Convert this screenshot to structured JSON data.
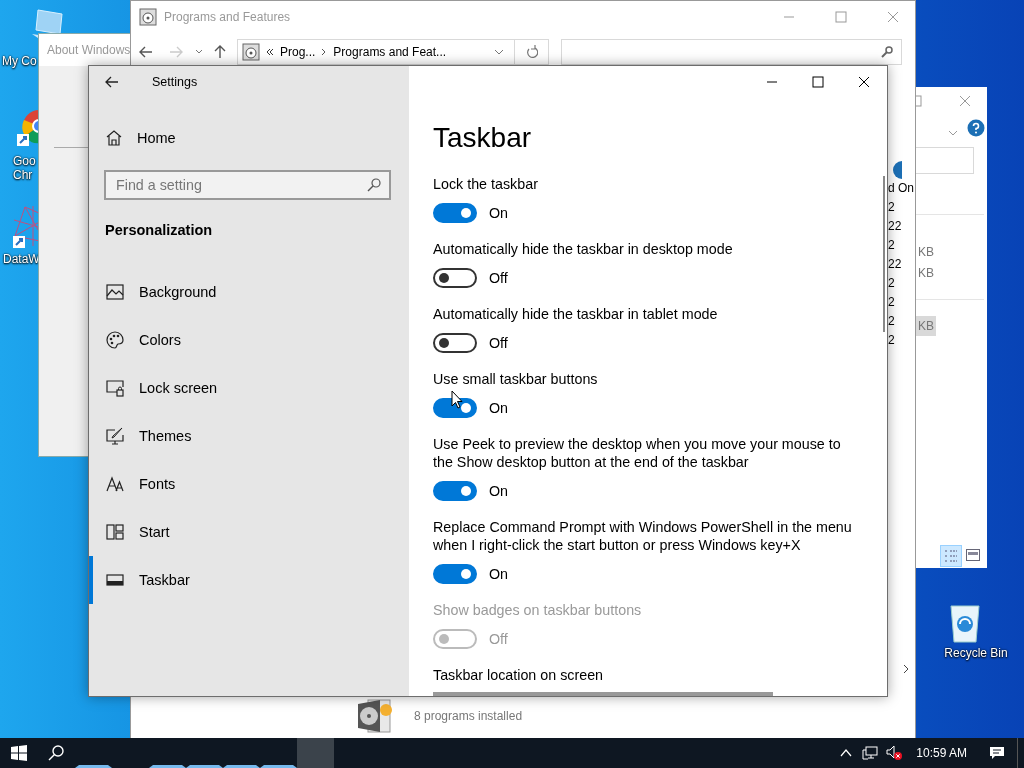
{
  "desktop_icons": [
    {
      "lines": [
        "My Co"
      ]
    },
    {
      "lines": [
        "Goo",
        "Chr"
      ]
    },
    {
      "lines": [
        "DataW"
      ]
    },
    {
      "lines": [
        "Recycle Bin"
      ]
    }
  ],
  "about_window": {
    "title": "About Windows"
  },
  "programs_window": {
    "title": "Programs and Features",
    "breadcrumb": [
      "Prog...",
      "Programs and Feat..."
    ],
    "column_header": "d On",
    "dates": [
      "2",
      "22",
      "2",
      "22",
      "2",
      "2",
      "2",
      "2"
    ],
    "status": "8 programs installed"
  },
  "right_window": {
    "sizes": [
      {
        "text": "KB",
        "selected": false
      },
      {
        "text": "KB",
        "selected": false
      },
      {
        "text": "KB",
        "selected": true
      }
    ]
  },
  "settings": {
    "title": "Settings",
    "home": "Home",
    "search": {
      "placeholder": "Find a setting"
    },
    "section": "Personalization",
    "nav": [
      {
        "label": "Background",
        "selected": false
      },
      {
        "label": "Colors",
        "selected": false
      },
      {
        "label": "Lock screen",
        "selected": false
      },
      {
        "label": "Themes",
        "selected": false
      },
      {
        "label": "Fonts",
        "selected": false
      },
      {
        "label": "Start",
        "selected": false
      },
      {
        "label": "Taskbar",
        "selected": true
      }
    ],
    "page_title": "Taskbar",
    "toggles": [
      {
        "label": "Lock the taskbar",
        "on": true,
        "disabled": false,
        "state_text": "On"
      },
      {
        "label": "Automatically hide the taskbar in desktop mode",
        "on": false,
        "disabled": false,
        "state_text": "Off"
      },
      {
        "label": "Automatically hide the taskbar in tablet mode",
        "on": false,
        "disabled": false,
        "state_text": "Off"
      },
      {
        "label": "Use small taskbar buttons",
        "on": true,
        "disabled": false,
        "state_text": "On"
      },
      {
        "label": "Use Peek to preview the desktop when you move your mouse to the Show desktop button at the end of the taskbar",
        "on": true,
        "disabled": false,
        "state_text": "On"
      },
      {
        "label": "Replace Command Prompt with Windows PowerShell in the menu when I right-click the start button or press Windows key+X",
        "on": true,
        "disabled": false,
        "state_text": "On"
      },
      {
        "label": "Show badges on taskbar buttons",
        "on": false,
        "disabled": true,
        "state_text": "Off"
      }
    ],
    "location_label": "Taskbar location on screen"
  },
  "taskbar": {
    "apps": [
      {
        "running": true,
        "selected": false
      },
      {
        "running": true,
        "selected": false
      },
      {
        "running": true,
        "selected": false
      },
      {
        "running": true,
        "selected": false
      },
      {
        "running": true,
        "selected": false
      },
      {
        "running": false,
        "selected": true
      }
    ],
    "time": "10:59 AM"
  }
}
